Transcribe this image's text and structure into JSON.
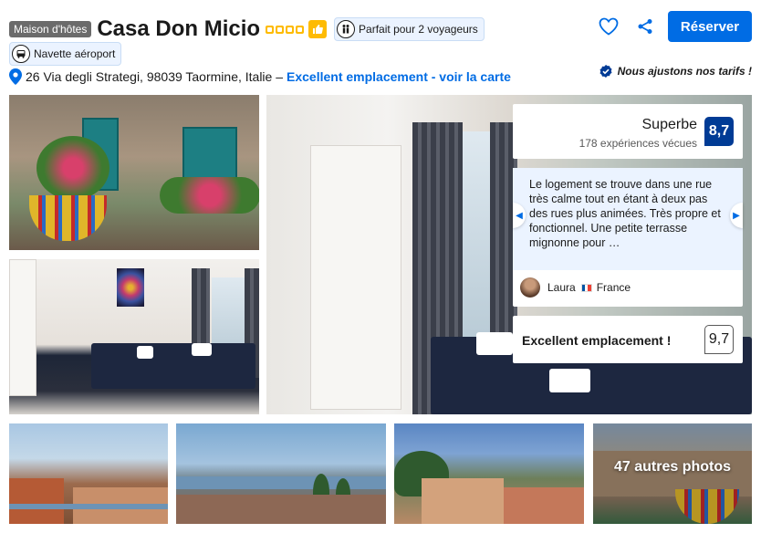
{
  "property": {
    "type_badge": "Maison d'hôtes",
    "name": "Casa Don Micio",
    "stars": 4,
    "travelers_pill": "Parfait pour 2 voyageurs",
    "shuttle_pill": "Navette aéroport",
    "address": "26 Via degli Strategi, 98039 Taormine, Italie –",
    "map_link": "Excellent emplacement - voir la carte"
  },
  "actions": {
    "reserve_label": "Réserver",
    "price_match": "Nous ajustons nos tarifs !"
  },
  "rating": {
    "label": "Superbe",
    "count": "178 expériences vécues",
    "score": "8,7"
  },
  "review": {
    "text": "Le logement se trouve dans une rue très calme tout en étant à deux pas des rues plus animées. Très propre et fonctionnel. Une petite terrasse mignonne pour …",
    "reviewer_name": "Laura",
    "reviewer_country": "France"
  },
  "location": {
    "label": "Excellent emplacement !",
    "score": "9,7"
  },
  "gallery": {
    "more_photos": "47 autres photos"
  },
  "colors": {
    "brand_blue": "#006ce4",
    "score_blue": "#003b95",
    "star_yellow": "#febb02",
    "quote_bg": "#ebf3ff"
  }
}
